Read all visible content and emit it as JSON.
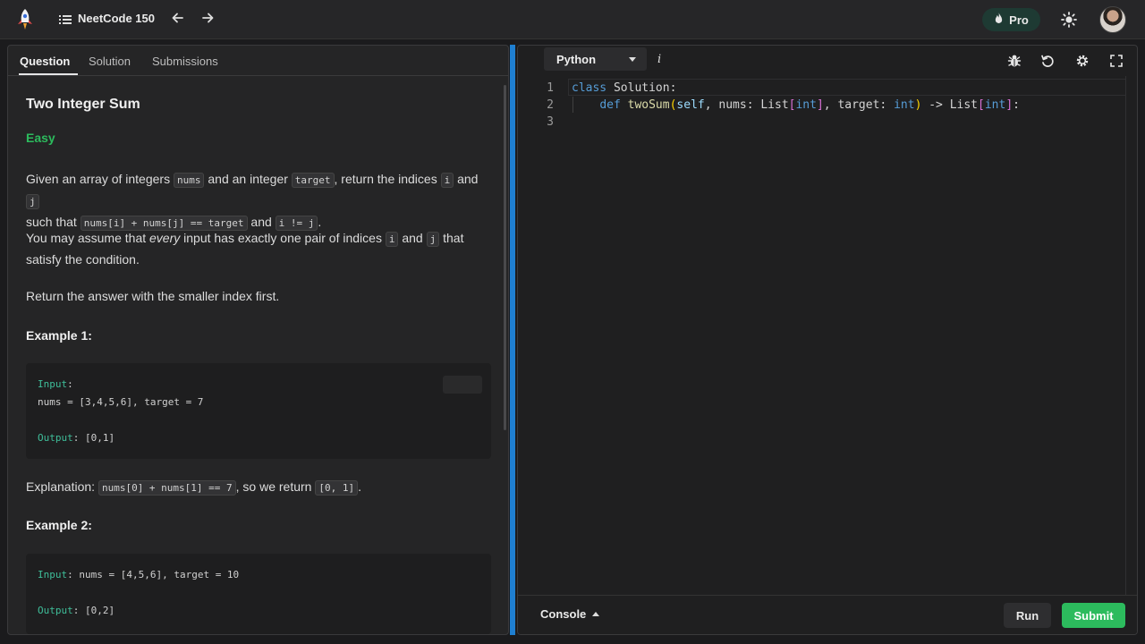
{
  "header": {
    "list_title": "NeetCode 150",
    "pro_label": "Pro",
    "icons": [
      "rocket-logo-icon",
      "list-icon",
      "arrow-left-icon",
      "arrow-right-icon",
      "flame-icon",
      "sun-icon",
      "avatar"
    ],
    "accent_color": "#2cbb5d"
  },
  "tabs": [
    {
      "label": "Question",
      "active": true
    },
    {
      "label": "Solution",
      "active": false
    },
    {
      "label": "Submissions",
      "active": false
    }
  ],
  "question": {
    "title": "Two Integer Sum",
    "difficulty": "Easy",
    "p1": {
      "t1": "Given an array of integers ",
      "c1": "nums",
      "t2": " and an integer ",
      "c2": "target",
      "t3": ", return the indices ",
      "c3": "i",
      "t4": " and ",
      "c4": "j",
      "t5": "such that ",
      "c5": "nums[i] + nums[j] == target",
      "t6": " and ",
      "c6": "i != j",
      "t7": "."
    },
    "p2": {
      "t1": "You may assume that ",
      "em": "every",
      "t2": " input has exactly one pair of indices ",
      "c1": "i",
      "t3": " and ",
      "c2": "j",
      "t4": " that",
      "t5": "satisfy the condition."
    },
    "p3": "Return the answer with the smaller index first.",
    "example1": {
      "title": "Example 1:",
      "input_label": "Input",
      "input_value": "nums = [3,4,5,6], target = 7",
      "output_label": "Output",
      "output_value": ": [0,1]"
    },
    "explanation": {
      "t1": "Explanation: ",
      "c1": "nums[0] + nums[1] == 7",
      "t2": ", so we return ",
      "c2": "[0, 1]",
      "t3": "."
    },
    "example2": {
      "title": "Example 2:",
      "input_label": "Input",
      "input_value": ": nums = [4,5,6], target = 10",
      "output_label": "Output",
      "output_value": ": [0,2]"
    }
  },
  "editor": {
    "language": "Python",
    "info_label": "i",
    "line_numbers": [
      "1",
      "2",
      "3"
    ],
    "code": {
      "l1_kw": "class",
      "l1_rest": " Solution:",
      "l2_indent": "    ",
      "l2_kw": "def",
      "l2_fn": " twoSum",
      "l2_open": "(",
      "l2_self": "self",
      "l2_a": ", nums: List",
      "l2_b1": "[",
      "l2_int1": "int",
      "l2_b2": "]",
      "l2_c": ", target: ",
      "l2_int2": "int",
      "l2_close": ")",
      "l2_d": " -> List",
      "l2_b3": "[",
      "l2_int3": "int",
      "l2_b4": "]",
      "l2_e": ":"
    },
    "toolbar_icons": [
      "bug-icon",
      "reset-icon",
      "settings-icon",
      "fullscreen-icon"
    ]
  },
  "footer": {
    "console_label": "Console",
    "run_label": "Run",
    "submit_label": "Submit"
  }
}
